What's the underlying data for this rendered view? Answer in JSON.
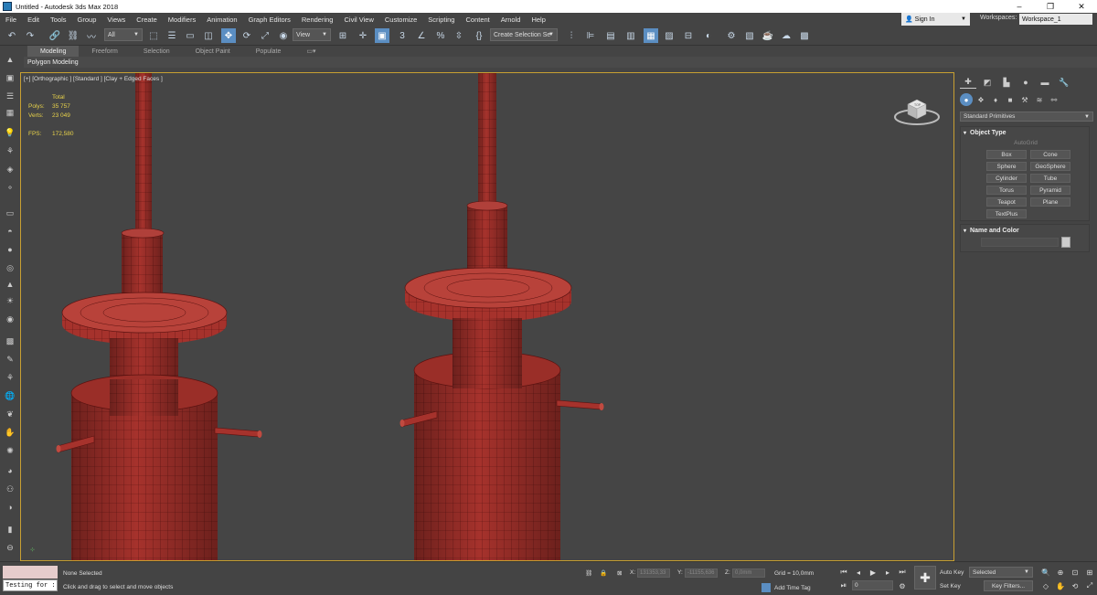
{
  "window": {
    "title": "Untitled - Autodesk 3ds Max 2018",
    "minimize": "–",
    "restore": "❐",
    "close": "✕"
  },
  "menu": {
    "items": [
      "File",
      "Edit",
      "Tools",
      "Group",
      "Views",
      "Create",
      "Modifiers",
      "Animation",
      "Graph Editors",
      "Rendering",
      "Civil View",
      "Customize",
      "Scripting",
      "Content",
      "Arnold",
      "Help"
    ],
    "sign_in": "Sign In",
    "workspaces_label": "Workspaces:",
    "workspace_value": "Workspace_1"
  },
  "toolbar": {
    "filter_value": "All",
    "ref_coord_value": "View",
    "selection_set_value": "Create Selection Se"
  },
  "ribbon": {
    "tabs": [
      "Modeling",
      "Freeform",
      "Selection",
      "Object Paint",
      "Populate"
    ],
    "active_tab": "Modeling",
    "panel_label": "Polygon Modeling"
  },
  "viewport": {
    "label": "[+] [Orthographic ] [Standard ] [Clay + Edged Faces ]",
    "stats": {
      "header": "Total",
      "polys_label": "Polys:",
      "polys_value": "35 757",
      "verts_label": "Verts:",
      "verts_value": "23 049",
      "fps_label": "FPS:",
      "fps_value": "172,580"
    },
    "viewcube_label": "TOP",
    "mesh_color": "#a6322c",
    "wire_color": "#5a1210",
    "background_color": "#454545",
    "border_color": "#c8a032"
  },
  "command_panel": {
    "primitives_value": "Standard Primitives",
    "object_type_title": "Object Type",
    "autogrid_label": "AutoGrid",
    "buttons": [
      "Box",
      "Cone",
      "Sphere",
      "GeoSphere",
      "Cylinder",
      "Tube",
      "Torus",
      "Pyramid",
      "Teapot",
      "Plane",
      "TextPlus"
    ],
    "name_color_title": "Name and Color"
  },
  "status": {
    "listener_text": "Testing for :",
    "selection_status": "None Selected",
    "prompt": "Click and drag to select and move objects",
    "x_label": "X:",
    "x_value": "131353,33",
    "y_label": "Y:",
    "y_value": "-11155,636",
    "z_label": "Z:",
    "z_value": "0,0mm",
    "grid": "Grid = 10,0mm",
    "add_time_tag": "Add Time Tag",
    "frame_value": "0",
    "auto_key": "Auto Key",
    "set_key": "Set Key",
    "key_mode_value": "Selected",
    "key_filters": "Key Filters..."
  }
}
